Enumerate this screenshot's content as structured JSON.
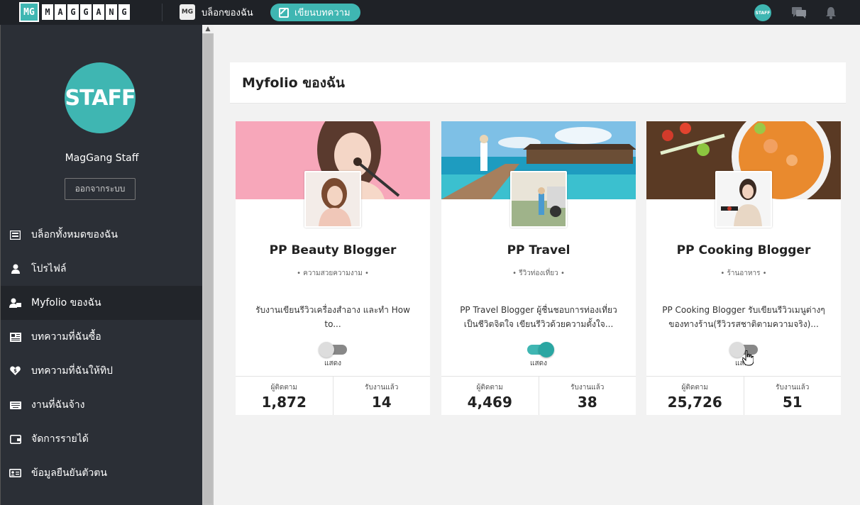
{
  "header": {
    "logo_mark": "MG",
    "logo_letters": [
      "M",
      "A",
      "G",
      "G",
      "A",
      "N",
      "G"
    ],
    "blog_label": "บล็อกของฉัน",
    "write_label": "เขียนบทความ",
    "avatar_text": "STAFF"
  },
  "sidebar": {
    "avatar_text": "STAFF",
    "user_name": "MagGang Staff",
    "logout_label": "ออกจากระบบ",
    "items": [
      {
        "label": "บล็อกทั้งหมดของฉัน",
        "icon": "list-icon"
      },
      {
        "label": "โปรไฟล์",
        "icon": "user-icon"
      },
      {
        "label": "Myfolio ของฉัน",
        "icon": "user-card-icon"
      },
      {
        "label": "บทความที่ฉันซื้อ",
        "icon": "article-icon"
      },
      {
        "label": "บทความที่ฉันให้ทิป",
        "icon": "heart-dollar-icon"
      },
      {
        "label": "งานที่ฉันจ้าง",
        "icon": "keyboard-icon"
      },
      {
        "label": "จัดการรายได้",
        "icon": "wallet-icon"
      },
      {
        "label": "ข้อมูลยืนยันตัวตน",
        "icon": "id-card-icon"
      }
    ]
  },
  "main": {
    "title": "Myfolio ของฉัน",
    "cards": [
      {
        "title": "PP Beauty Blogger",
        "category": "• ความสวยความงาม •",
        "desc_line1": "รับงานเขียนรีวิวเครื่องสำอาง และทำ How",
        "desc_line2": "to...",
        "toggle_on": false,
        "toggle_label": "แสดง",
        "followers_label": "ผู้ติดตาม",
        "followers": "1,872",
        "jobs_label": "รับงานแล้ว",
        "jobs": "14"
      },
      {
        "title": "PP Travel",
        "category": "• รีวิวท่องเที่ยว •",
        "desc_line1": "PP Travel Blogger ผู้ชื่นชอบการท่องเที่ยว",
        "desc_line2": "เป็นชีวิตจิตใจ เขียนรีวิวด้วยความตั้งใจ...",
        "toggle_on": true,
        "toggle_label": "แสดง",
        "followers_label": "ผู้ติดตาม",
        "followers": "4,469",
        "jobs_label": "รับงานแล้ว",
        "jobs": "38"
      },
      {
        "title": "PP Cooking Blogger",
        "category": "• ร้านอาหาร •",
        "desc_line1": "PP Cooking Blogger รับเขียนรีวิวเมนูต่างๆ",
        "desc_line2": "ของทางร้าน(รีวิวรสชาติตามความจริง)...",
        "toggle_on": false,
        "toggle_label": "แสดง",
        "followers_label": "ผู้ติดตาม",
        "followers": "25,726",
        "jobs_label": "รับงานแล้ว",
        "jobs": "51"
      }
    ]
  },
  "colors": {
    "accent": "#3fb6b2",
    "topbar": "#1f2227",
    "sidebar": "#2b2f36"
  }
}
